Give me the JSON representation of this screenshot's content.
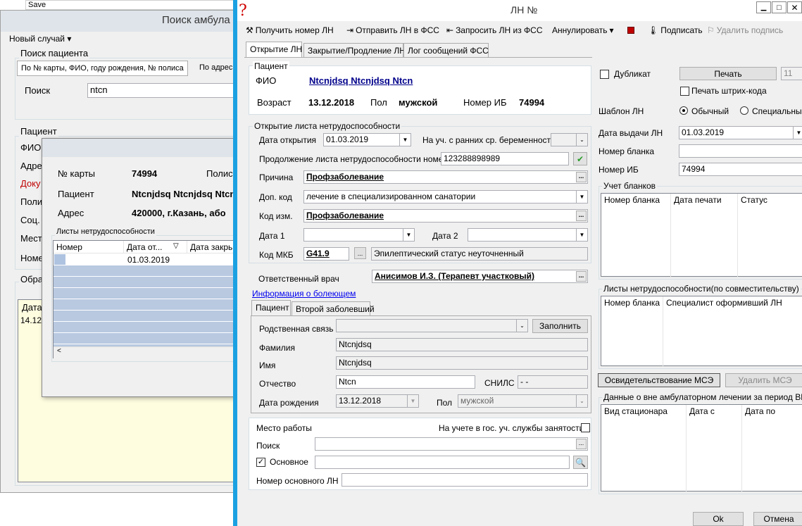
{
  "bg": {
    "save": "Save"
  },
  "search_window": {
    "title": "Поиск амбула",
    "menu": "Новый случай",
    "patient_search": {
      "group": "Поиск пациента",
      "tab1": "По № карты, ФИО, году рождения, № полиса",
      "tab2": "По адрес",
      "label": "Поиск",
      "value": "ntcn"
    },
    "patient_group": "Пациент",
    "patient_labels": [
      "ФИО",
      "Адре",
      "Доку",
      "Поли",
      "Соц.",
      "Мест",
      "Номе"
    ],
    "appeal_group": "Обра",
    "appeal_header": "Дата",
    "appeal_row": "14.12"
  },
  "card_dialog": {
    "card_label": "№ карты",
    "card_value": "74994",
    "policy_label": "Полис",
    "patient_label": "Пациент",
    "patient_value": "Ntcnjdsq Ntcnjdsq Ntcn",
    "address_label": "Адрес",
    "address_value": "420000, г.Казань, або",
    "sheets_group": "Листы нетрудоспособности",
    "columns": [
      "Номер",
      "Дата от...",
      "Дата закрь"
    ],
    "row_date": "01.03.2019"
  },
  "ln_window": {
    "title": "ЛН №",
    "toolbar": {
      "get_number": "Получить номер ЛН",
      "send": "Отправить ЛН в ФСС",
      "request": "Запросить ЛН из ФСС",
      "annul": "Аннулировать",
      "sign": "Подписать",
      "remove_sign": "Удалить подпись"
    },
    "tabs": [
      "Открытие ЛН",
      "Закрытие/Продление ЛН",
      "Лог сообщений ФСС"
    ],
    "patient": {
      "group": "Пациент",
      "fio_label": "ФИО",
      "fio": "Ntcnjdsq Ntcnjdsq Ntcn",
      "age_label": "Возраст",
      "age": "13.12.2018",
      "sex_label": "Пол",
      "sex": "мужской",
      "ib_label": "Номер ИБ",
      "ib": "74994"
    },
    "opening": {
      "group": "Открытие листа нетрудоспособности",
      "date_label": "Дата открытия",
      "date": "01.03.2019",
      "early_label": "На уч. с ранних ср. беременности",
      "cont_label": "Продолжение листа нетрудоспособности номер",
      "cont_value": "123288898989",
      "reason_label": "Причина",
      "reason": "Профзаболевание",
      "dop_label": "Доп. код",
      "dop": "лечение в специализированном санатории",
      "change_label": "Код изм.",
      "change": "Профзаболевание",
      "date1_label": "Дата 1",
      "date2_label": "Дата 2",
      "mkb_label": "Код МКБ",
      "mkb": "G41.9",
      "mkb_text": "Эпилептический статус неуточненный"
    },
    "doctor_label": "Ответственный врач",
    "doctor": "Анисимов И.З. (Терапевт участковый)",
    "sick_info_link": "Информация о болеющем",
    "sub_tabs": [
      "Пациент",
      "Второй заболевший"
    ],
    "relative": {
      "relation_label": "Родственная связь",
      "fill_button": "Заполнить",
      "surname_label": "Фамилия",
      "surname": "Ntcnjdsq",
      "name_label": "Имя",
      "name": "Ntcnjdsq",
      "patronymic_label": "Отчество",
      "patronymic": "Ntcn",
      "snils_label": "СНИЛС",
      "snils": "-  -",
      "birth_label": "Дата рождения",
      "birth": "13.12.2018",
      "sex_label": "Пол",
      "sex": "мужской"
    },
    "work": {
      "group": "Место работы",
      "employment_label": "На учете в гос. уч. службы занятости",
      "search_label": "Поиск",
      "main_label": "Основное",
      "main_ln_label": "Номер основного ЛН"
    },
    "right": {
      "duplicate": "Дубликат",
      "print": "Печать",
      "copies": "11",
      "barcode": "Печать штрих-кода",
      "template_label": "Шаблон ЛН",
      "template_normal": "Обычный",
      "template_special": "Специальный",
      "issue_label": "Дата выдачи ЛН",
      "issue_date": "01.03.2019",
      "blank_label": "Номер бланка",
      "ib_label": "Номер ИБ",
      "ib": "74994",
      "blanks_group": "Учет бланков",
      "blanks_cols": [
        "Номер бланка",
        "Дата печати",
        "Статус"
      ],
      "part_group": "Листы нетрудоспособности(по совместительству)",
      "part_cols": [
        "Номер бланка",
        "Специалист оформивший ЛН"
      ],
      "mse_button": "Освидетельствование МСЭ",
      "del_mse_button": "Удалить МСЭ",
      "hosp_group": "Данные о вне амбулаторном лечении за период ВН",
      "hosp_cols": [
        "Вид стационара",
        "Дата с",
        "Дата по"
      ]
    },
    "ok": "Ok",
    "cancel": "Отмена"
  }
}
